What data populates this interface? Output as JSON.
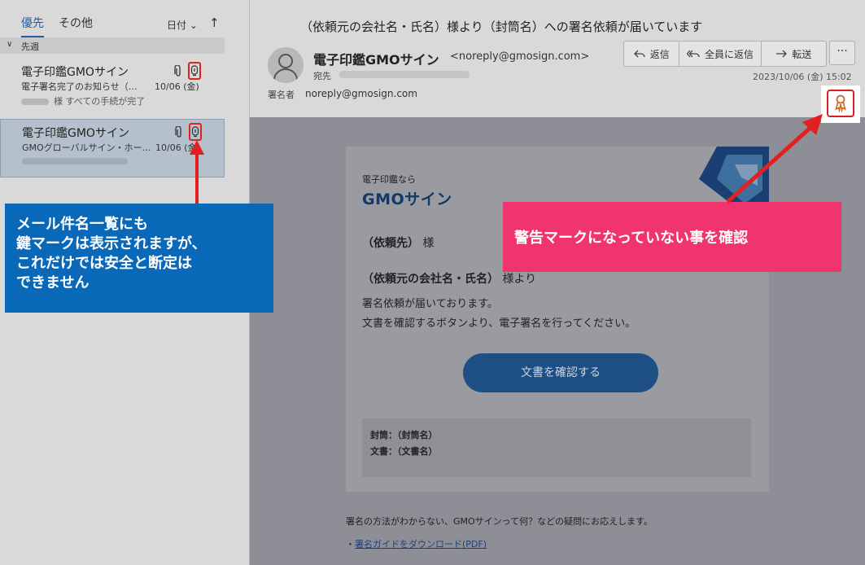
{
  "list": {
    "tab_focused": "優先",
    "tab_other": "その他",
    "sort_label": "日付",
    "sort_dir": "↑",
    "group_label": "先週",
    "messages": [
      {
        "sender": "電子印鑑GMOサイン",
        "subject": "電子署名完了のお知らせ（…",
        "date": "10/06 (金)",
        "preview": "様 すべての手続が完了"
      },
      {
        "sender": "電子印鑑GMOサイン",
        "subject": "GMOグローバルサイン・ホー…",
        "date": "10/06 (金)",
        "preview": ""
      }
    ]
  },
  "reading": {
    "subject": "（依頼元の会社名・氏名）様より（封筒名）への署名依頼が届いています",
    "from_name": "電子印鑑GMOサイン",
    "from_email": "<noreply@gmosign.com>",
    "to_label": "宛先",
    "signer_label": "署名者",
    "signer_email": "noreply@gmosign.com",
    "datetime": "2023/10/06 (金) 15:02",
    "actions": {
      "reply": "返信",
      "reply_all": "全員に返信",
      "forward": "転送",
      "more": "···"
    }
  },
  "body": {
    "brand_small": "電子印鑑なら",
    "brand_logo": "GMOサイン",
    "recipient_bold": "（依頼先）",
    "recipient_suffix": "様",
    "sender_bold": "（依頼元の会社名・氏名）",
    "sender_suffix": "様より",
    "line1": "署名依頼が届いております。",
    "line2": "文書を確認するボタンより、電子署名を行ってください。",
    "confirm_button": "文書を確認する",
    "envelope": "封筒：（封筒名）",
    "document": "文書：（文書名）",
    "help": "署名の方法がわからない、GMOサインって何？などの疑問にお応えします。",
    "guide_prefix": "・",
    "guide_link": "署名ガイドをダウンロード(PDF)"
  },
  "callouts": {
    "blue": [
      "メール件名一覧にも",
      "鍵マークは表示されますが、",
      "これだけでは安全と断定は",
      "できません"
    ],
    "pink": "警告マークになっていない事を確認"
  },
  "colors": {
    "accent_red": "#e41f1f",
    "callout_blue": "#0a68b8",
    "callout_pink": "#f0356e",
    "button_navy": "#1d4f85"
  }
}
